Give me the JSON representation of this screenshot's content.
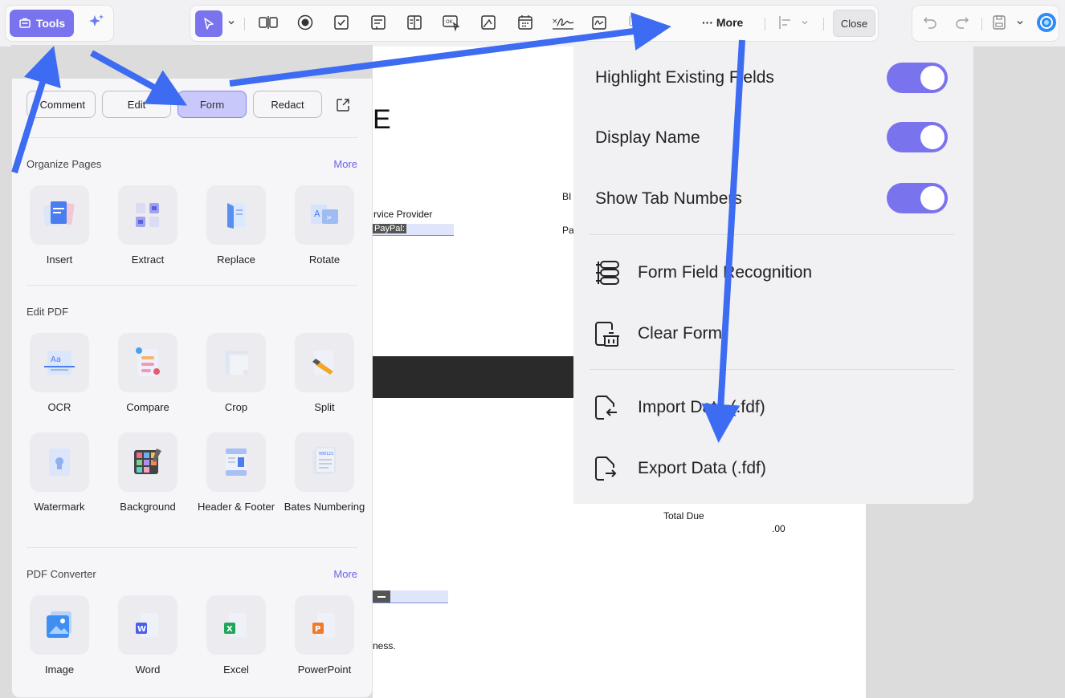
{
  "toolbar": {
    "tools_label": "Tools",
    "more_label": "More",
    "close_label": "Close"
  },
  "panel": {
    "modes": [
      "Comment",
      "Edit",
      "Form",
      "Redact"
    ],
    "active_mode": "Form",
    "sections": [
      {
        "title": "Organize Pages",
        "more": "More",
        "items": [
          "Insert",
          "Extract",
          "Replace",
          "Rotate"
        ]
      },
      {
        "title": "Edit PDF",
        "items": [
          "OCR",
          "Compare",
          "Crop",
          "Split",
          "Watermark",
          "Background",
          "Header & Footer",
          "Bates Numbering"
        ]
      },
      {
        "title": "PDF Converter",
        "more": "More",
        "items": [
          "Image",
          "Word",
          "Excel",
          "PowerPoint"
        ]
      }
    ]
  },
  "menu": {
    "toggles": [
      {
        "label": "Highlight Existing Fields",
        "on": true
      },
      {
        "label": "Display Name",
        "on": true
      },
      {
        "label": "Show Tab Numbers",
        "on": true
      }
    ],
    "actions": [
      "Form Field Recognition",
      "Clear Form",
      "Import Data (.fdf)",
      "Export Data (.fdf)"
    ]
  },
  "document": {
    "char_e": "E",
    "service_provider": "rvice Provider",
    "paypal": "PayPal:",
    "bi": "BI",
    "pa": "Pa",
    "total_due": "Total Due",
    "amount": ".00",
    "ness": "ness."
  },
  "colors": {
    "accent": "#7a73ee",
    "arrow": "#3d6bf2",
    "toggle_on": "#7a73ee"
  }
}
